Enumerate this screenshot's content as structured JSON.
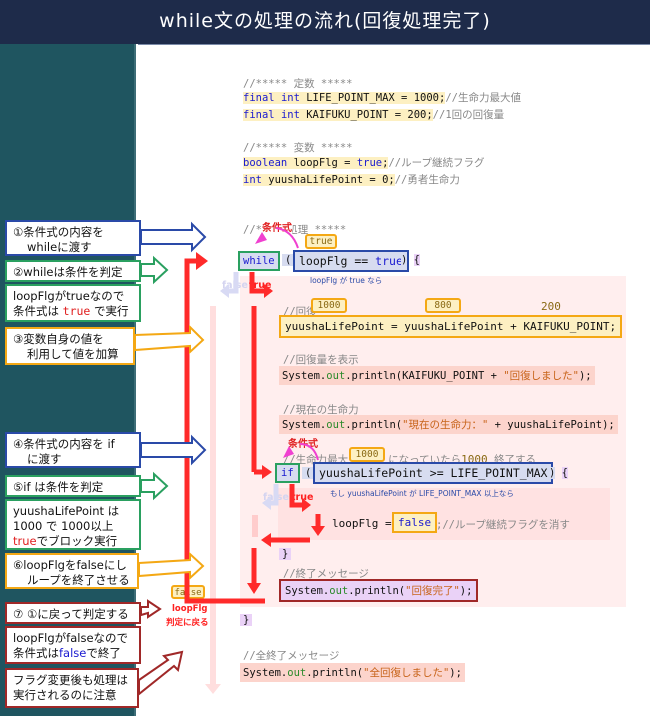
{
  "header": {
    "title": "while文の処理の流れ(回復処理完了)"
  },
  "code": {
    "const_comment": "//***** 定数 *****",
    "const1_code": "final int LIFE_POINT_MAX = 1000;",
    "const1_final": "final",
    "const1_int": "int",
    "const1_rest": " LIFE_POINT_MAX = 1000;",
    "const1_comment": "//生命力最大値",
    "const2_final": "final",
    "const2_int": "int",
    "const2_rest": " KAIFUKU_POINT = 200;",
    "const2_comment": "//1回の回復量",
    "var_comment": "//***** 変数 *****",
    "var1_type": "boolean",
    "var1_mid": " loopFlg = ",
    "var1_val": "true",
    "var1_end": ";",
    "var1_comment": "//ループ継続フラグ",
    "var2_type": "int",
    "var2_rest": " yuushaLifePoint = 0;",
    "var2_comment": "//勇者生命力",
    "proc_comment": "//*****処理 *****",
    "while_kw": "while",
    "open_paren": "(",
    "while_cond_var": "loopFlg == ",
    "while_cond_val": "true",
    "close_brace_open": ") {",
    "while_note": "loopFlg が true なら",
    "heal_comment": "//回復",
    "heal_line": "yuushaLifePoint = yuushaLifePoint + KAIFUKU_POINT;",
    "show_comment": "//回復量を表示",
    "show_sys": "System.",
    "show_out": "out",
    "show_println": ".println(KAIFUKU_POINT + ",
    "show_str": "\"回復しました\"",
    "show_end": ");",
    "cur_comment": "//現在の生命力",
    "cur_sys": "System.",
    "cur_out": "out",
    "cur_println": ".println(",
    "cur_str": "\"現在の生命力：\"",
    "cur_end": " + yuushaLifePoint);",
    "if_comment_a": "//生命力最大",
    "if_comment_b": "になっていたら",
    "if_comment_c": "終了する",
    "if_kw": "if",
    "if_cond": "yuushaLifePoint >= LIFE_POINT_MAX",
    "if_note": "もし yuushaLifePoint が LIFE_POINT_MAX 以上なら",
    "flag_assign": "loopFlg = ",
    "flag_val": "false",
    "flag_comment": ";//ループ継続フラグを消す",
    "if_close": "}",
    "end_comment": "//終了メッセージ",
    "end_sys": "System.",
    "end_out": "out",
    "end_println": ".println(",
    "end_str": "\"回復完了\"",
    "end_end": ");",
    "while_close": "}",
    "all_comment": "//全終了メッセージ",
    "all_sys": "System.",
    "all_out": "out",
    "all_println": ".println(",
    "all_str": "\"全回復しました\"",
    "all_end": ");"
  },
  "annotations": {
    "cond_label_while": "条件式",
    "cond_label_if": "条件式",
    "tag_true": "true",
    "tag_1000_a": "1000",
    "tag_800": "800",
    "val_200": "200",
    "tag_1000_b": "1000",
    "val_1000_c": "1000",
    "tag_false": "false",
    "while_false": "false",
    "while_true": "true",
    "if_false": "false",
    "if_true": "true",
    "return_label_1": "loopFlg",
    "return_label_2": "判定に戻る"
  },
  "steps": [
    {
      "id": 1,
      "line1": "①条件式の内容を",
      "line2": "whileに渡す",
      "color": "#2a4aa8"
    },
    {
      "id": 2,
      "line1": "②whileは条件を判定",
      "color": "#2aa060",
      "detail1": "loopFlgがtrueなので",
      "detail2a": "条件式は ",
      "detail2b": "true",
      "detail2c": " で実行"
    },
    {
      "id": 3,
      "line1": "③変数自身の値を",
      "line2": "利用して値を加算",
      "color": "#f4a814"
    },
    {
      "id": 4,
      "line1": "④条件式の内容を if",
      "line2": "に渡す",
      "color": "#2a4aa8"
    },
    {
      "id": 5,
      "line1": "⑤if は条件を判定",
      "color": "#2aa060",
      "detail1": "yuushaLifePoint は",
      "detail2": "1000 で 1000以上",
      "detail3a": "true",
      "detail3b": "でブロック実行"
    },
    {
      "id": 6,
      "line1": "⑥loopFlgをfalseにし",
      "line2": "ループを終了させる",
      "color": "#f4a814"
    },
    {
      "id": 7,
      "line1": "⑦ ①に戻って判定する",
      "color": "#a02828",
      "detail1": "loopFlgがfalseなので",
      "detail2a": "条件式は",
      "detail2b": "false",
      "detail2c": "で終了"
    },
    {
      "id": 8,
      "line1": "フラグ変更後も処理は",
      "line2": "実行されるのに注意",
      "color": "#a02828"
    }
  ],
  "colors": {
    "title_bg": "#1e2b4a",
    "sidebar_bg": "#1f5560",
    "flow_red": "#ff2a2a",
    "blue": "#2a4aa8",
    "green": "#2aa060",
    "orange": "#f4a814",
    "dark_red": "#a02828",
    "magenta": "#f040d0"
  }
}
